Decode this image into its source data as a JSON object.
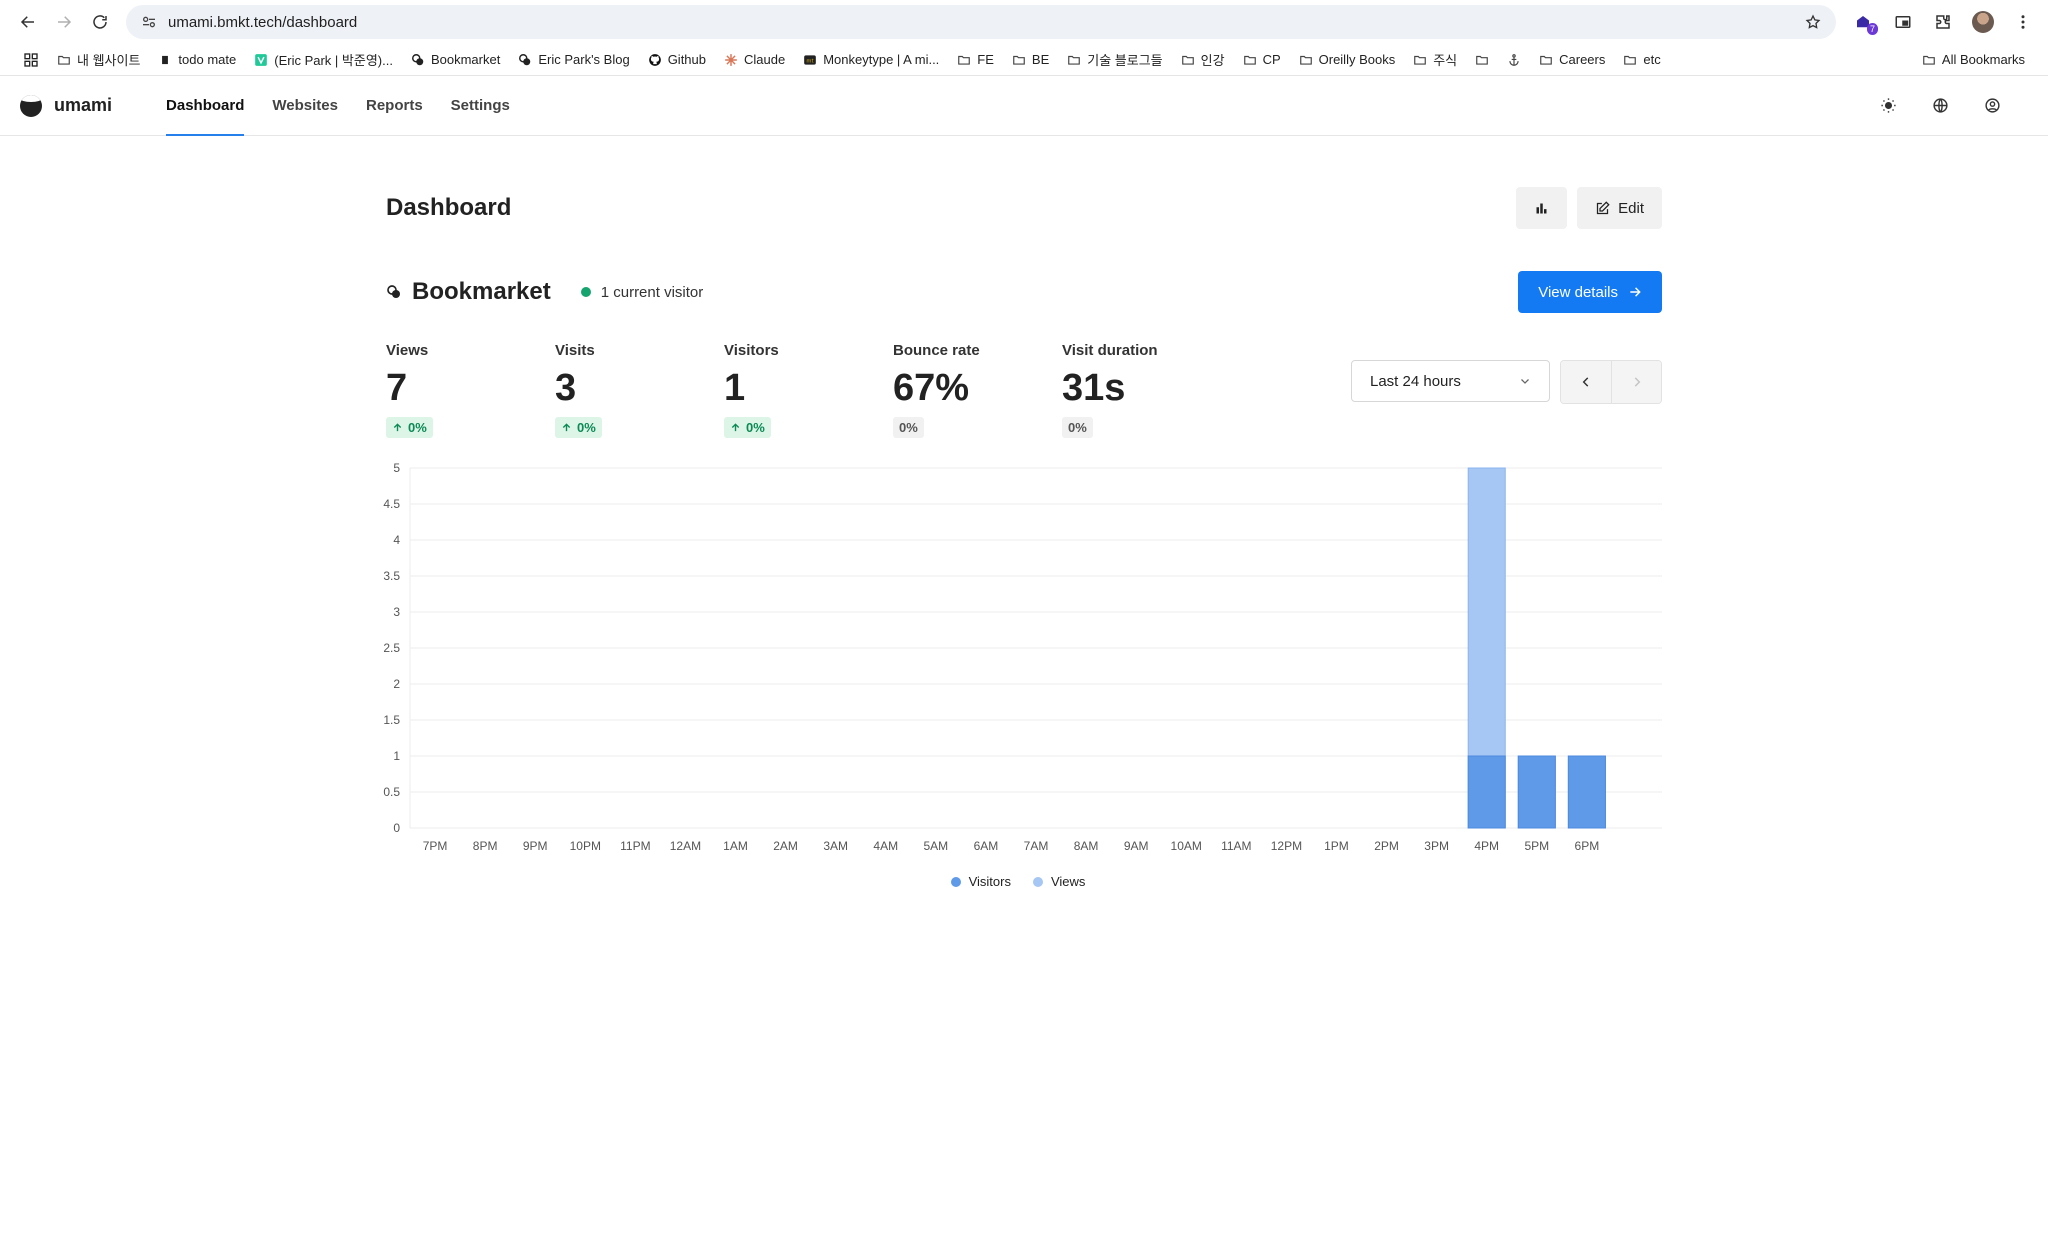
{
  "browser": {
    "url": "umami.bmkt.tech/dashboard",
    "extension_badge": "7",
    "bookmarks": [
      {
        "label": "내 웹사이트",
        "icon": "folder-icon"
      },
      {
        "label": "todo mate",
        "icon": "todo-icon"
      },
      {
        "label": "(Eric Park | 박준영)...",
        "icon": "v-icon"
      },
      {
        "label": "Bookmarket",
        "icon": "bookmarket-icon"
      },
      {
        "label": "Eric Park's Blog",
        "icon": "blog-icon"
      },
      {
        "label": "Github",
        "icon": "github-icon"
      },
      {
        "label": "Claude",
        "icon": "claude-icon"
      },
      {
        "label": "Monkeytype | A mi...",
        "icon": "monkeytype-icon"
      },
      {
        "label": "FE",
        "icon": "folder-icon"
      },
      {
        "label": "BE",
        "icon": "folder-icon"
      },
      {
        "label": "기술 블로그들",
        "icon": "folder-icon"
      },
      {
        "label": "인강",
        "icon": "folder-icon"
      },
      {
        "label": "CP",
        "icon": "folder-icon"
      },
      {
        "label": "Oreilly Books",
        "icon": "folder-icon"
      },
      {
        "label": "주식",
        "icon": "folder-icon"
      },
      {
        "label": "",
        "icon": "folder-icon"
      },
      {
        "label": "",
        "icon": "anchor-icon"
      },
      {
        "label": "Careers",
        "icon": "folder-icon"
      },
      {
        "label": "etc",
        "icon": "folder-icon"
      }
    ],
    "all_bookmarks": "All Bookmarks"
  },
  "app": {
    "logo": "umami",
    "nav": [
      {
        "label": "Dashboard",
        "active": true
      },
      {
        "label": "Websites",
        "active": false
      },
      {
        "label": "Reports",
        "active": false
      },
      {
        "label": "Settings",
        "active": false
      }
    ]
  },
  "page": {
    "title": "Dashboard",
    "edit_label": "Edit"
  },
  "website": {
    "name": "Bookmarket",
    "current_visitors": "1 current visitor",
    "view_details": "View details"
  },
  "metrics": [
    {
      "label": "Views",
      "value": "7",
      "change": "0%",
      "trend": "up"
    },
    {
      "label": "Visits",
      "value": "3",
      "change": "0%",
      "trend": "up"
    },
    {
      "label": "Visitors",
      "value": "1",
      "change": "0%",
      "trend": "up"
    },
    {
      "label": "Bounce rate",
      "value": "67%",
      "change": "0%",
      "trend": "neutral"
    },
    {
      "label": "Visit duration",
      "value": "31s",
      "change": "0%",
      "trend": "neutral"
    }
  ],
  "filters": {
    "date_range": "Last 24 hours"
  },
  "colors": {
    "visitors": "#5f9ae8",
    "views": "#a6c6f4",
    "accent": "#147af3"
  },
  "chart_data": {
    "type": "bar",
    "stacked": true,
    "categories": [
      "7PM",
      "8PM",
      "9PM",
      "10PM",
      "11PM",
      "12AM",
      "1AM",
      "2AM",
      "3AM",
      "4AM",
      "5AM",
      "6AM",
      "7AM",
      "8AM",
      "9AM",
      "10AM",
      "11AM",
      "12PM",
      "1PM",
      "2PM",
      "3PM",
      "4PM",
      "5PM",
      "6PM",
      "7PM"
    ],
    "series": [
      {
        "name": "Visitors",
        "values": [
          0,
          0,
          0,
          0,
          0,
          0,
          0,
          0,
          0,
          0,
          0,
          0,
          0,
          0,
          0,
          0,
          0,
          0,
          0,
          0,
          0,
          1,
          1,
          1,
          0
        ]
      },
      {
        "name": "Views",
        "values": [
          0,
          0,
          0,
          0,
          0,
          0,
          0,
          0,
          0,
          0,
          0,
          0,
          0,
          0,
          0,
          0,
          0,
          0,
          0,
          0,
          0,
          5,
          1,
          1,
          0
        ]
      }
    ],
    "yticks": [
      "0",
      "0.5",
      "1",
      "1.5",
      "2",
      "2.5",
      "3",
      "3.5",
      "4",
      "4.5",
      "5"
    ],
    "xticks": [
      "7PM",
      "8PM",
      "9PM",
      "10PM",
      "11PM",
      "12AM",
      "1AM",
      "2AM",
      "3AM",
      "4AM",
      "5AM",
      "6AM",
      "7AM",
      "8AM",
      "9AM",
      "10AM",
      "11AM",
      "12PM",
      "1PM",
      "2PM",
      "3PM",
      "4PM",
      "5PM",
      "6PM"
    ],
    "ylim": [
      0,
      5
    ],
    "grid": true,
    "legend_position": "bottom"
  }
}
